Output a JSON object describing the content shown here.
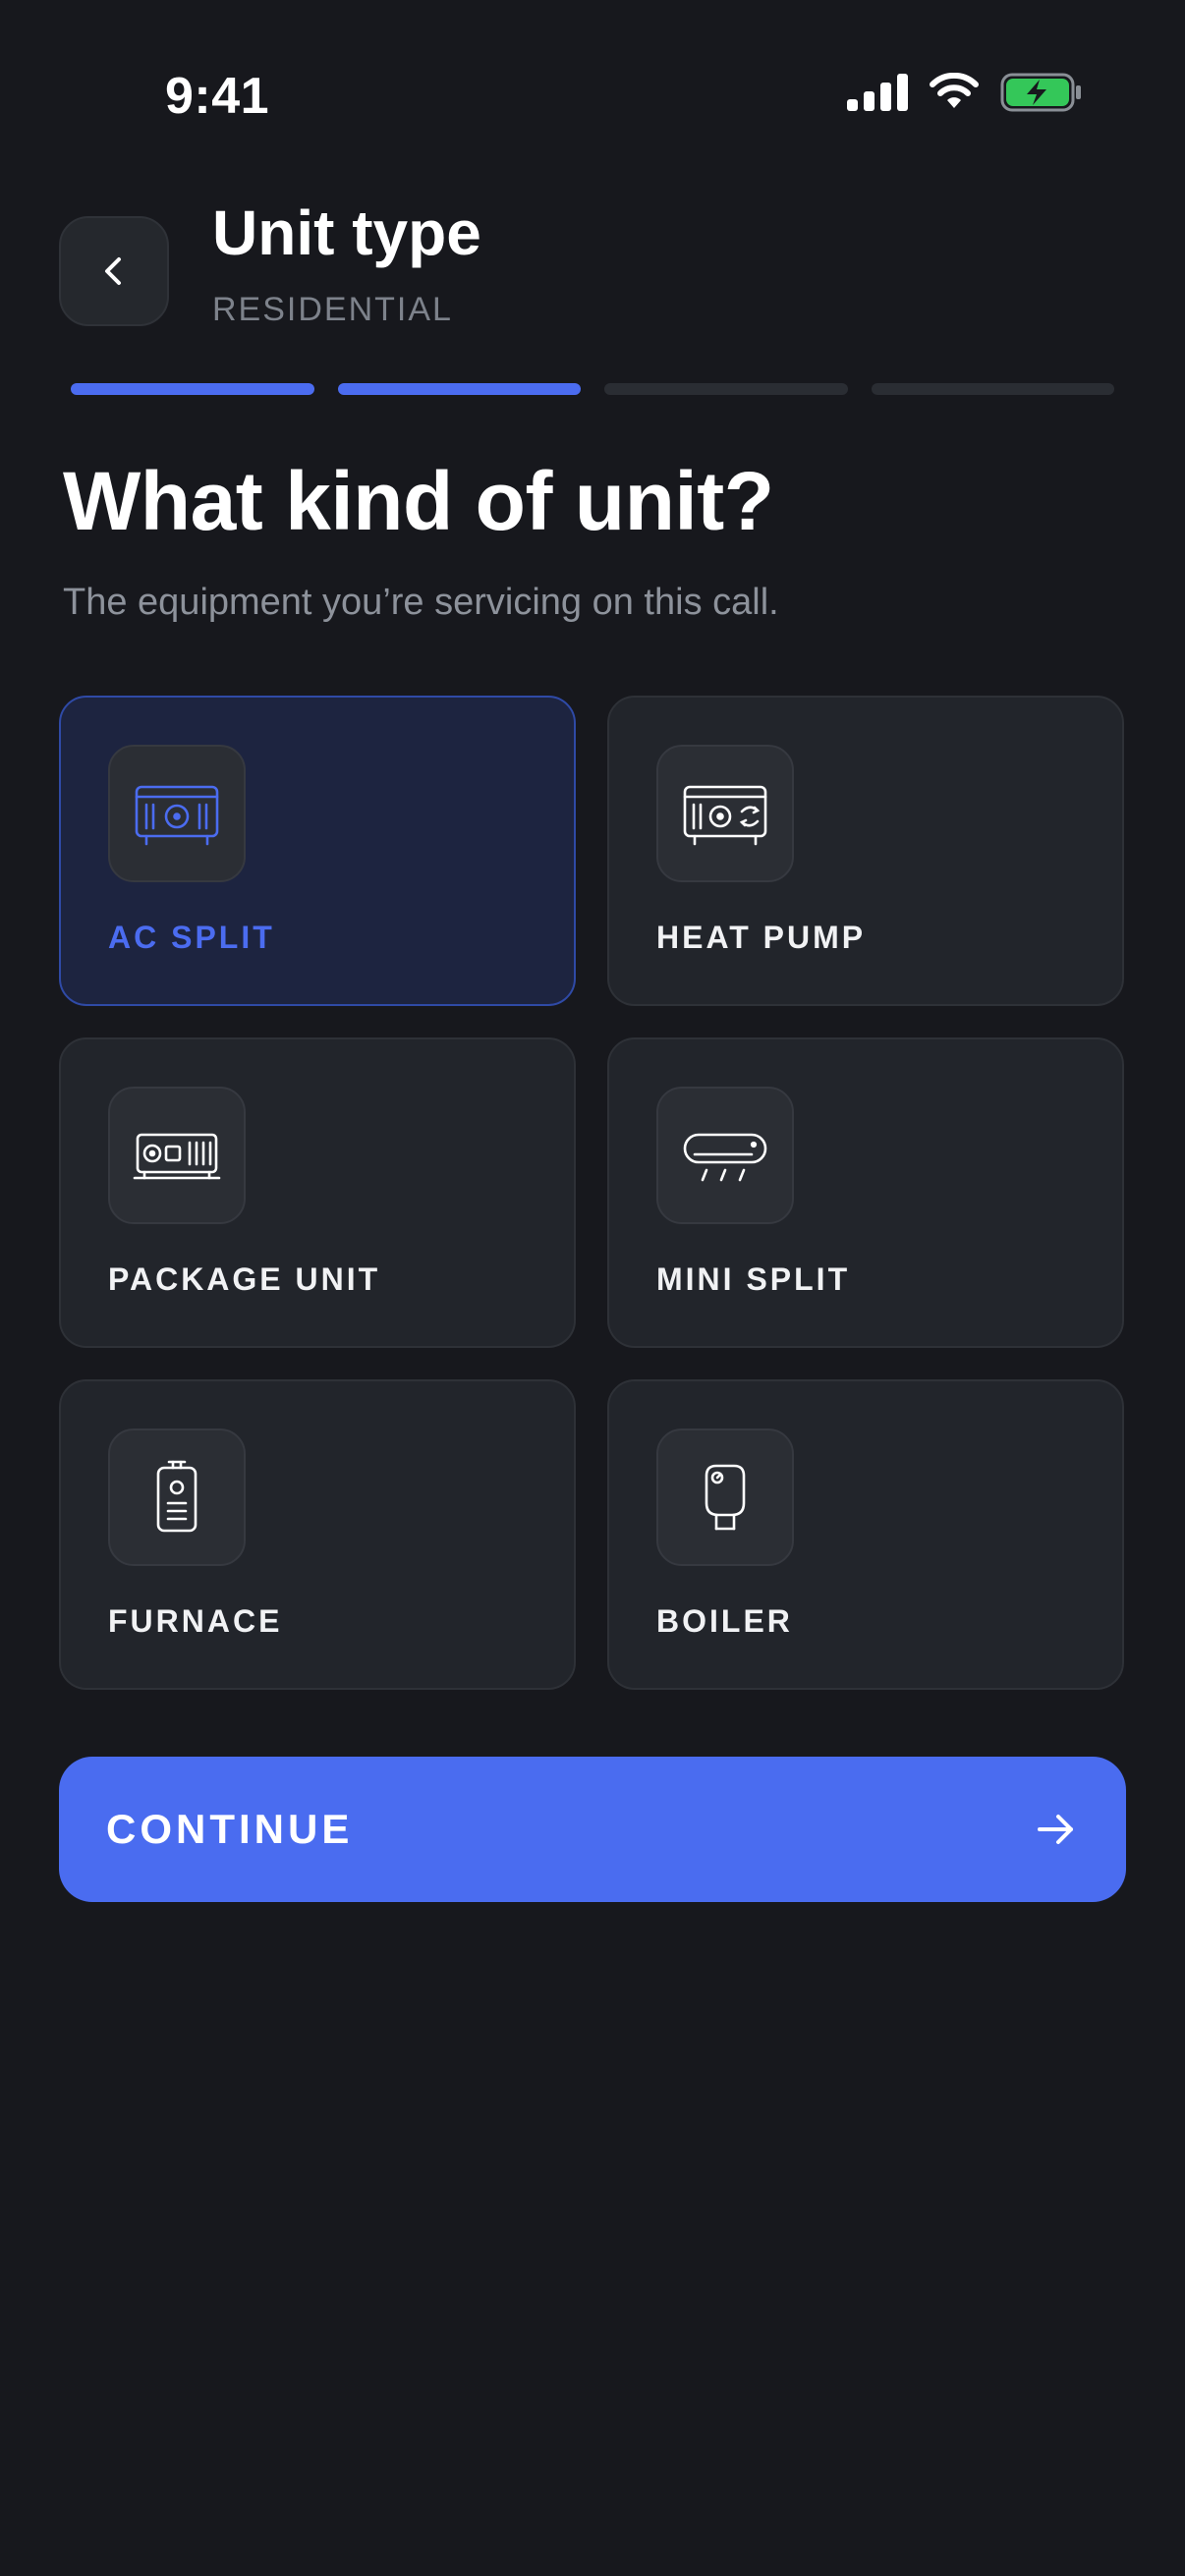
{
  "status_bar": {
    "time": "9:41",
    "icons": [
      "signal-icon",
      "wifi-icon",
      "battery-charging-icon"
    ],
    "battery_color": "#34c759"
  },
  "header": {
    "back_icon": "chevron-left-icon",
    "title": "Unit type",
    "subtitle": "RESIDENTIAL"
  },
  "progress": {
    "total_steps": 4,
    "completed_steps": 2,
    "active_color": "#4b6cf0"
  },
  "question": {
    "title": "What kind of unit?",
    "subtitle": "The equipment you’re servicing on this call."
  },
  "options": [
    {
      "label": "AC SPLIT",
      "icon": "ac-split-icon",
      "selected": true
    },
    {
      "label": "HEAT PUMP",
      "icon": "heat-pump-icon",
      "selected": false
    },
    {
      "label": "PACKAGE UNIT",
      "icon": "package-unit-icon",
      "selected": false
    },
    {
      "label": "MINI SPLIT",
      "icon": "mini-split-icon",
      "selected": false
    },
    {
      "label": "FURNACE",
      "icon": "furnace-icon",
      "selected": false
    },
    {
      "label": "BOILER",
      "icon": "boiler-icon",
      "selected": false
    }
  ],
  "continue_button": {
    "label": "CONTINUE",
    "icon": "arrow-right-icon",
    "color": "#4a6cf0"
  }
}
